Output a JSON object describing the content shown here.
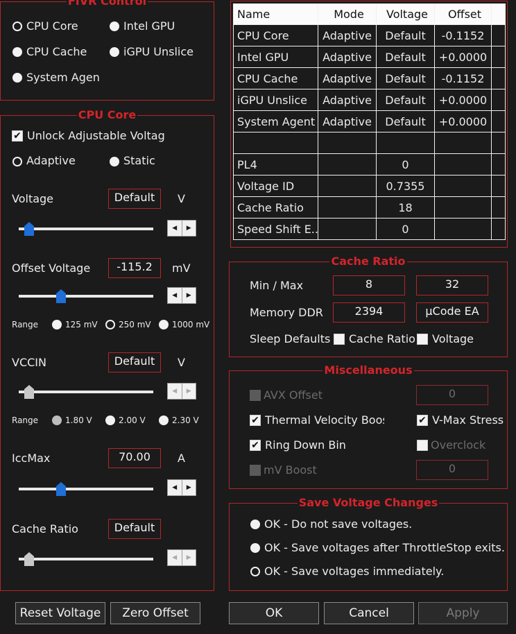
{
  "fivr": {
    "title": "FIVR Control",
    "options": [
      "CPU Core",
      "Intel GPU",
      "CPU Cache",
      "iGPU Unslice",
      "System Agen"
    ]
  },
  "cpucore": {
    "title": "CPU Core",
    "unlock_label": "Unlock Adjustable Voltag",
    "adaptive_label": "Adaptive",
    "static_label": "Static",
    "voltage_label": "Voltage",
    "voltage_value": "Default",
    "voltage_unit": "V",
    "offset_label": "Offset Voltage",
    "offset_value": "-115.2",
    "offset_unit": "mV",
    "range_label": "Range",
    "offset_ranges": [
      "125 mV",
      "250 mV",
      "1000 mV"
    ],
    "vccin_label": "VCCIN",
    "vccin_value": "Default",
    "vccin_unit": "V",
    "vccin_ranges": [
      "1.80 V",
      "2.00 V",
      "2.30 V"
    ],
    "iccmax_label": "IccMax",
    "iccmax_value": "70.00",
    "iccmax_unit": "A",
    "cache_label": "Cache Ratio",
    "cache_value": "Default",
    "spin_left": "◀",
    "spin_right": "▶"
  },
  "table": {
    "headers": [
      "Name",
      "Mode",
      "Voltage",
      "Offset"
    ],
    "rows": [
      [
        "CPU Core",
        "Adaptive",
        "Default",
        "-0.1152"
      ],
      [
        "Intel GPU",
        "Adaptive",
        "Default",
        "+0.0000"
      ],
      [
        "CPU Cache",
        "Adaptive",
        "Default",
        "-0.1152"
      ],
      [
        "iGPU Unslice",
        "Adaptive",
        "Default",
        "+0.0000"
      ],
      [
        "System Agent",
        "Adaptive",
        "Default",
        "+0.0000"
      ],
      [
        "",
        "",
        "",
        ""
      ],
      [
        "PL4",
        "",
        "0",
        ""
      ],
      [
        "Voltage ID",
        "",
        "0.7355",
        ""
      ],
      [
        "Cache Ratio",
        "",
        "18",
        ""
      ],
      [
        "Speed Shift E...",
        "",
        "0",
        ""
      ]
    ]
  },
  "cacheratio": {
    "title": "Cache Ratio",
    "minmax_label": "Min / Max",
    "min": "8",
    "max": "32",
    "memory_label": "Memory DDR",
    "memory_value": "2394",
    "ucode_value": "µCode  EA",
    "sleep_label": "Sleep Defaults",
    "sleep_cache_label": "Cache Ratio",
    "sleep_voltage_label": "Voltage"
  },
  "misc": {
    "title": "Miscellaneous",
    "avx_label": "AVX Offset",
    "avx_value": "0",
    "tvb_label": "Thermal Velocity Boost",
    "vmax_label": "V-Max Stress",
    "ringdown_label": "Ring Down Bin",
    "overclock_label": "Overclock",
    "mvboost_label": "mV Boost",
    "mvboost_value": "0",
    "check_mark": "✔"
  },
  "save": {
    "title": "Save Voltage Changes",
    "options": [
      "OK - Do not save voltages.",
      "OK - Save voltages after ThrottleStop exits.",
      "OK - Save voltages immediately."
    ]
  },
  "buttons": {
    "reset": "Reset Voltage",
    "zero": "Zero Offset",
    "ok": "OK",
    "cancel": "Cancel",
    "apply": "Apply"
  },
  "sliders": {
    "voltage": 0.04,
    "offset": 0.28,
    "vccin": 0.04,
    "iccmax": 0.28,
    "cache": 0.04
  },
  "colors": {
    "accent": "#d4242b",
    "thumb_active": "#1f6fd6",
    "thumb_disabled": "#c8c8c8"
  }
}
